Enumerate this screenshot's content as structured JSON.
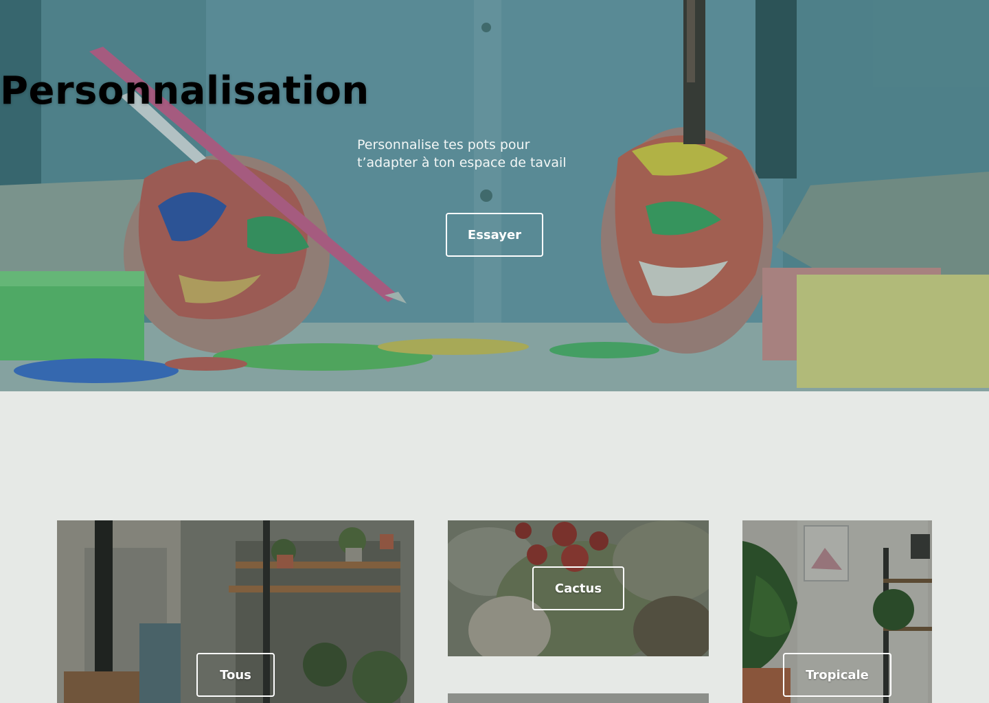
{
  "hero": {
    "title": "Personnalisation",
    "subtitle_line1": "Personnalise tes pots pour",
    "subtitle_line2": "t’adapter à ton espace de tavail",
    "cta_label": "Essayer"
  },
  "categories": {
    "tous_label": "Tous",
    "cactus_label": "Cactus",
    "tropicale_label": "Tropicale"
  },
  "colors": {
    "page_background": "#e6e9e6",
    "hero_tint": "#4f7f86",
    "button_border": "#ffffff"
  }
}
